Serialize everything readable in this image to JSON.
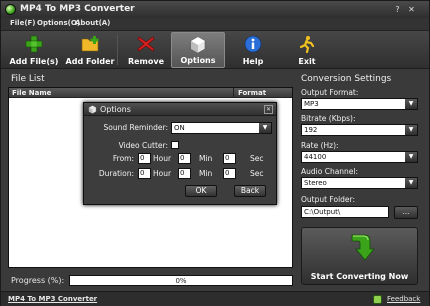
{
  "window": {
    "title": "MP4 To MP3 Converter",
    "controls": {
      "help": "?",
      "close": "✕"
    }
  },
  "menu": {
    "items": [
      "File(F)",
      "Options(O)",
      "About(A)"
    ]
  },
  "toolbar": {
    "buttons": [
      {
        "label": "Add File(s)",
        "icon": "add-file-icon"
      },
      {
        "label": "Add Folder",
        "icon": "add-folder-icon"
      },
      {
        "label": "Remove",
        "icon": "remove-icon"
      },
      {
        "label": "Options",
        "icon": "options-icon"
      },
      {
        "label": "Help",
        "icon": "help-icon"
      },
      {
        "label": "Exit",
        "icon": "exit-icon"
      }
    ],
    "active": "Options"
  },
  "file_list": {
    "title": "File List",
    "columns": [
      "File Name",
      "Format"
    ]
  },
  "progress": {
    "label": "Progress (%):",
    "value_text": "0%",
    "value": 0
  },
  "status": {
    "app_link": "MP4 To MP3 Converter",
    "feedback": "Feedback"
  },
  "settings": {
    "title": "Conversion Settings",
    "output_format": {
      "label": "Output Format:",
      "value": "MP3"
    },
    "bitrate": {
      "label": "Bitrate (Kbps):",
      "value": "192"
    },
    "rate": {
      "label": "Rate (Hz):",
      "value": "44100"
    },
    "channel": {
      "label": "Audio Channel:",
      "value": "Stereo"
    },
    "folder": {
      "label": "Output Folder:",
      "value": "C:\\Output\\",
      "browse": "..."
    },
    "convert": "Start Converting Now"
  },
  "options_dialog": {
    "title": "Options",
    "close": "✕",
    "sound_reminder": {
      "label": "Sound Reminder:",
      "value": "ON"
    },
    "video_cutter": {
      "label": "Video Cutter:",
      "checked": false
    },
    "from": {
      "label": "From:",
      "hour": "0",
      "min": "0",
      "sec": "0"
    },
    "duration": {
      "label": "Duration:",
      "hour": "0",
      "min": "0",
      "sec": "0"
    },
    "units": {
      "hour": "Hour",
      "min": "Min",
      "sec": "Sec"
    },
    "ok": "OK",
    "back": "Back"
  },
  "colors": {
    "accent_green": "#3aa31a",
    "remove_red": "#d42020",
    "help_blue": "#2b6fd6",
    "exit_yellow": "#f0c020"
  }
}
